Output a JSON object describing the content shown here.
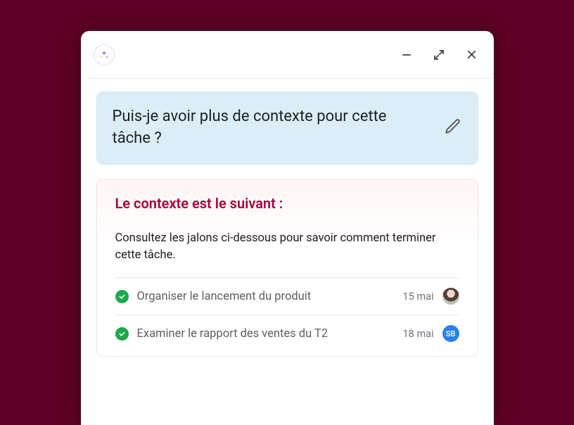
{
  "query": {
    "text": "Puis-je avoir plus de contexte pour cette tâche ?"
  },
  "context": {
    "title": "Le contexte est le suivant :",
    "description": "Consultez les jalons ci-dessous pour savoir comment terminer cette tâche.",
    "milestones": [
      {
        "label": "Organiser le lancement du produit",
        "date": "15 mai",
        "avatar_type": "photo",
        "avatar_text": ""
      },
      {
        "label": "Examiner le rapport des ventes du T2",
        "date": "18 mai",
        "avatar_type": "initials",
        "avatar_text": "SB"
      }
    ]
  }
}
